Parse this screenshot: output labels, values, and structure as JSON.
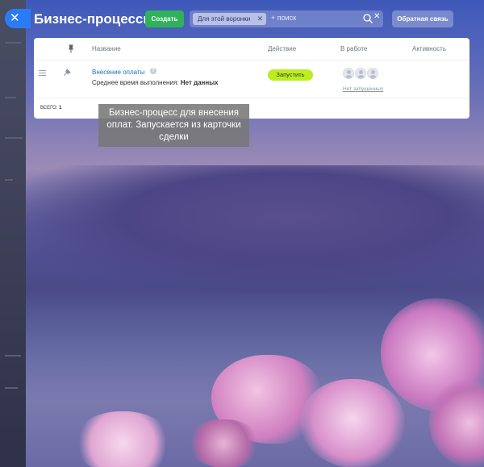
{
  "header": {
    "title": "Бизнес-процессы",
    "create_label": "Создать",
    "filter_tag": "Для этой воронки",
    "search_placeholder": "+ поиск",
    "feedback_label": "Обратная связь"
  },
  "table": {
    "columns": {
      "name": "Название",
      "action": "Действие",
      "in_progress": "В работе",
      "activity": "Активность"
    },
    "rows": [
      {
        "name": "Внесение оплаты",
        "avg_label": "Среднее время выполнения:",
        "avg_value": "Нет данных",
        "action_label": "Запустить",
        "not_started_label": "Нет запущенных"
      }
    ],
    "total_label": "ВСЕГО:",
    "total_value": "1"
  },
  "tooltip": {
    "text": "Бизнес-процесс для внесения оплат. Запускается из карточки сделки"
  },
  "colors": {
    "create_button": "#2fb25b",
    "run_button": "#bbed21",
    "close_button": "#2a7cf6",
    "link": "#1f6bc4"
  },
  "icons": [
    "close-icon",
    "pin-icon",
    "drag-handle-icon",
    "help-icon",
    "search-icon",
    "clear-icon",
    "avatar-icon"
  ]
}
